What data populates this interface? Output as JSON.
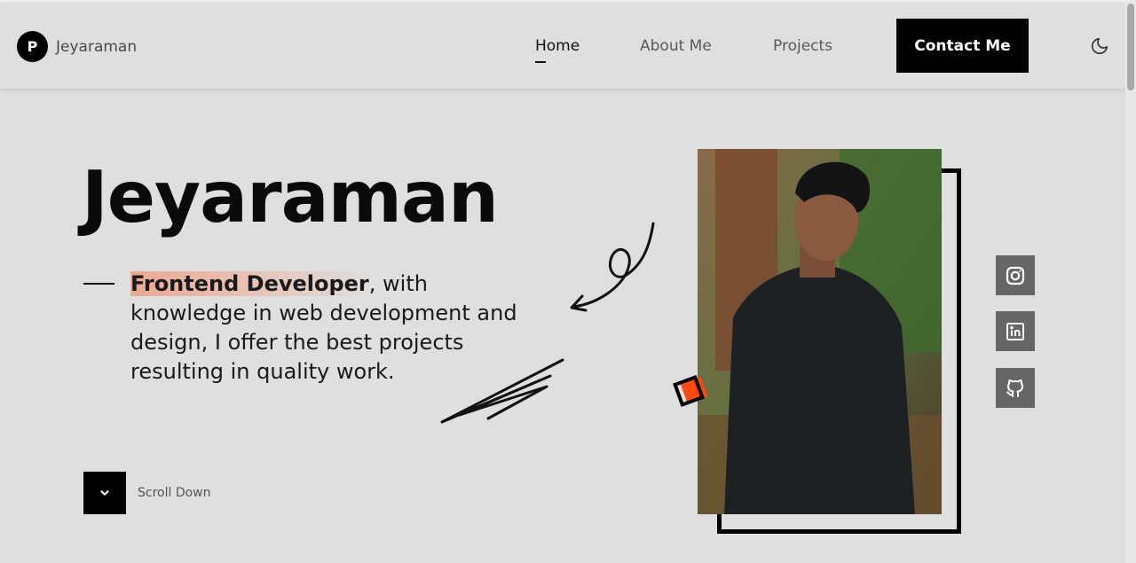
{
  "header": {
    "logo_letter": "P",
    "logo_name": "Jeyaraman",
    "nav": [
      {
        "label": "Home",
        "active": true
      },
      {
        "label": "About Me",
        "active": false
      },
      {
        "label": "Projects",
        "active": false
      }
    ],
    "contact_label": "Contact Me",
    "theme_icon": "moon-icon"
  },
  "hero": {
    "name": "Jeyaraman",
    "tagline_highlight": "Frontend Developer",
    "tagline_rest": ", with knowledge in web development and design, I offer the best projects resulting in quality work.",
    "scroll_label": "Scroll Down"
  },
  "social": [
    {
      "icon": "instagram-icon"
    },
    {
      "icon": "linkedin-icon"
    },
    {
      "icon": "github-icon"
    }
  ],
  "colors": {
    "background": "#dfdfdf",
    "accent": "#ff4a10",
    "dark": "#000000",
    "social_bg": "#666666"
  }
}
